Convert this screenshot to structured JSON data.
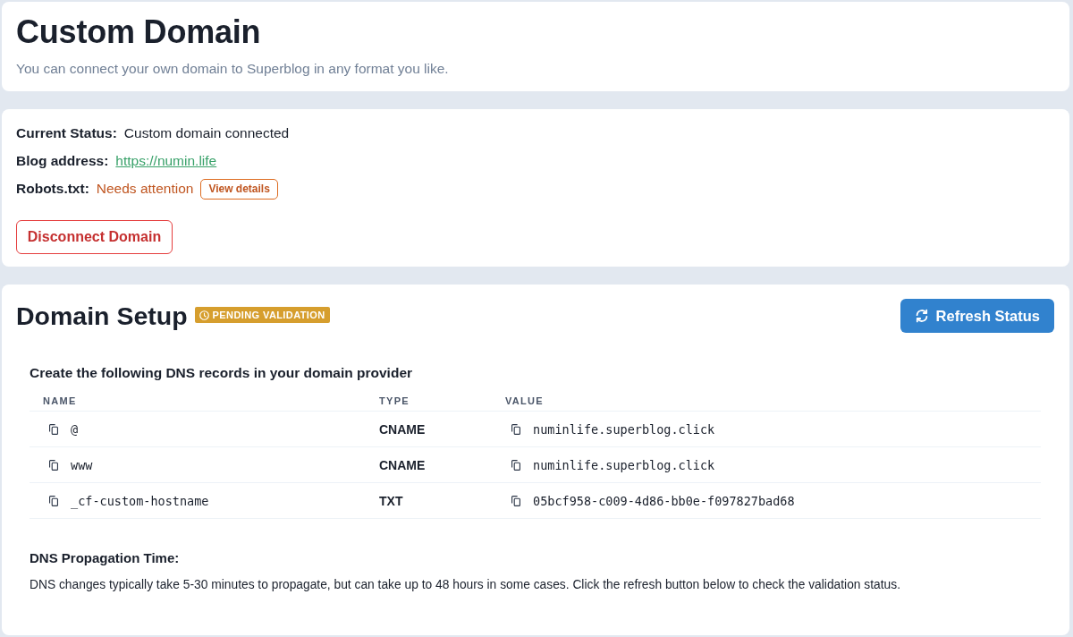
{
  "header": {
    "title": "Custom Domain",
    "subtitle": "You can connect your own domain to Superblog in any format you like."
  },
  "status": {
    "fields": [
      {
        "kind": "text",
        "label": "Current Status:",
        "value": "Custom domain connected"
      },
      {
        "kind": "link",
        "label": "Blog address:",
        "value": "https://numin.life"
      },
      {
        "kind": "warning",
        "label": "Robots.txt:",
        "value": "Needs attention",
        "action": "View details"
      }
    ],
    "disconnect_button": "Disconnect Domain"
  },
  "domain_setup": {
    "title": "Domain Setup",
    "badge": "PENDING VALIDATION",
    "refresh_button": "Refresh Status",
    "instructions": "Create the following DNS records in your domain provider",
    "table": {
      "columns": [
        "NAME",
        "TYPE",
        "VALUE"
      ],
      "rows": [
        {
          "name": "@",
          "type": "CNAME",
          "value": "numinlife.superblog.click"
        },
        {
          "name": "www",
          "type": "CNAME",
          "value": "numinlife.superblog.click"
        },
        {
          "name": "_cf-custom-hostname",
          "type": "TXT",
          "value": "05bcf958-c009-4d86-bb0e-f097827bad68"
        }
      ]
    },
    "note": {
      "title": "DNS Propagation Time:",
      "text": "DNS changes typically take 5-30 minutes to propagate, but can take up to 48 hours in some cases. Click the refresh button below to check the validation status."
    }
  }
}
